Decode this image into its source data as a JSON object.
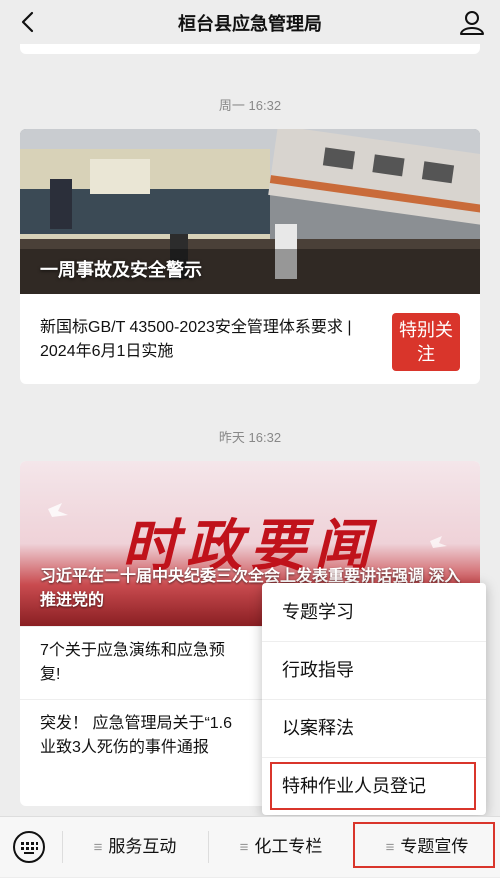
{
  "header": {
    "title": "桓台县应急管理局",
    "back_icon": "back-chevron-icon",
    "user_icon": "user-icon"
  },
  "timestamps": {
    "first": "周一 16:32",
    "second": "昨天 16:32"
  },
  "card1": {
    "hero_caption": "一周事故及安全警示",
    "sub_text": "新国标GB/T 43500-2023安全管理体系要求 | 2024年6月1日实施",
    "badge": "特别关注"
  },
  "card2": {
    "hero_big": "时政要闻",
    "hero_caption": "习近平在二十届中央纪委三次全会上发表重要讲话强调 深入推进党的",
    "items": [
      "7个关于应急演练和应急预",
      "复!",
      "突发！ 应急管理局关于“1.6",
      "业致3人死伤的事件通报"
    ]
  },
  "popup": {
    "items": [
      "专题学习",
      "行政指导",
      "以案释法",
      "特种作业人员登记"
    ]
  },
  "bottombar": {
    "keyboard_icon": "keyboard-icon",
    "tabs": [
      "服务互动",
      "化工专栏",
      "专题宣传"
    ]
  },
  "colors": {
    "accent": "#d9352b",
    "background": "#ededed"
  }
}
